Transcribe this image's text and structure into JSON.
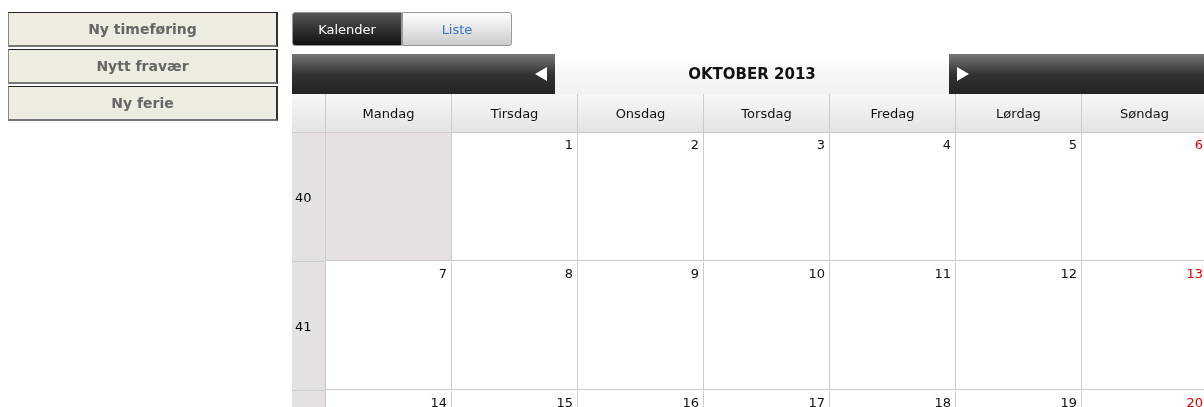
{
  "sidebar": {
    "buttons": [
      "Ny timeføring",
      "Nytt fravær",
      "Ny ferie"
    ]
  },
  "view_tabs": [
    {
      "label": "Kalender",
      "selected": true
    },
    {
      "label": "Liste",
      "selected": false
    }
  ],
  "calendar": {
    "title": "OKTOBER 2013",
    "weekdays": [
      "Mandag",
      "Tirsdag",
      "Onsdag",
      "Torsdag",
      "Fredag",
      "Lørdag",
      "Søndag"
    ],
    "weeks": [
      {
        "number": "40",
        "days": [
          {
            "kind": "empty"
          },
          {
            "kind": "weekday",
            "date": "1"
          },
          {
            "kind": "weekday",
            "date": "2"
          },
          {
            "kind": "weekday",
            "date": "3"
          },
          {
            "kind": "weekday",
            "date": "4"
          },
          {
            "kind": "weekday",
            "date": "5"
          },
          {
            "kind": "sunday",
            "date": "6"
          }
        ]
      },
      {
        "number": "41",
        "days": [
          {
            "kind": "weekday",
            "date": "7"
          },
          {
            "kind": "weekday",
            "date": "8"
          },
          {
            "kind": "weekday",
            "date": "9"
          },
          {
            "kind": "weekday",
            "date": "10"
          },
          {
            "kind": "weekday",
            "date": "11"
          },
          {
            "kind": "weekday",
            "date": "12"
          },
          {
            "kind": "sunday",
            "date": "13"
          }
        ]
      },
      {
        "days": [
          {
            "kind": "weekday",
            "date": "14"
          },
          {
            "kind": "weekday",
            "date": "15"
          },
          {
            "kind": "weekday",
            "date": "16"
          },
          {
            "kind": "weekday",
            "date": "17"
          },
          {
            "kind": "weekday",
            "date": "18"
          },
          {
            "kind": "weekday",
            "date": "19"
          },
          {
            "kind": "sunday",
            "date": "20"
          }
        ]
      }
    ]
  }
}
